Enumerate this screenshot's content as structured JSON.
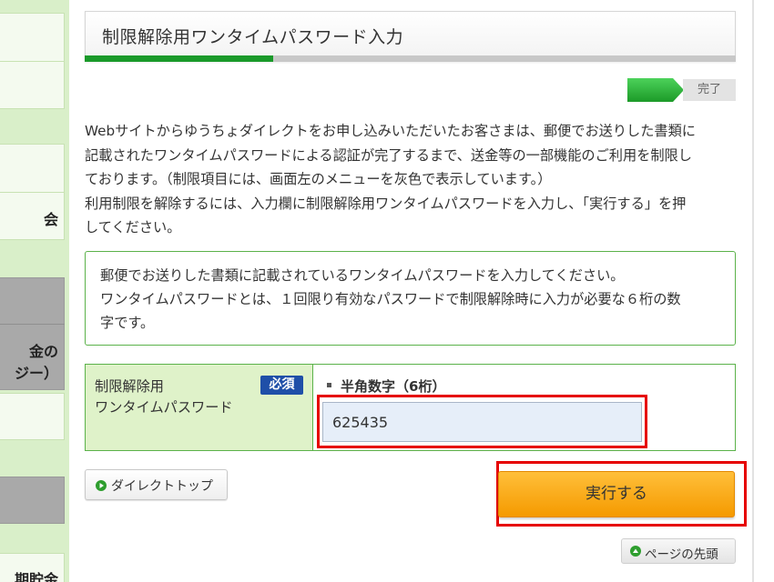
{
  "sidebar": {
    "items": [
      {
        "label": ""
      },
      {
        "label": ""
      },
      {
        "label": "会"
      },
      {
        "label": ""
      },
      {
        "label": "金の"
      },
      {
        "label": "ジー）"
      },
      {
        "label": ""
      },
      {
        "label": "期貯金"
      }
    ]
  },
  "header": {
    "title": "制限解除用ワンタイムパスワード入力",
    "progress": 0.29
  },
  "steps": {
    "current_label": "",
    "done_label": "完了"
  },
  "description": {
    "lines": [
      "Webサイトからゆうちょダイレクトをお申し込みいただいたお客さまは、郵便でお送りした書類に",
      "記載されたワンタイムパスワードによる認証が完了するまで、送金等の一部機能のご利用を制限し",
      "ております。（制限項目には、画面左のメニューを灰色で表示しています。）",
      "利用制限を解除するには、入力欄に制限解除用ワンタイムパスワードを入力し、「実行する」を押",
      "してください。"
    ]
  },
  "info": {
    "lines": [
      "郵便でお送りした書類に記載されているワンタイムパスワードを入力してください。",
      "ワンタイムパスワードとは、１回限り有効なパスワードで制限解除時に入力が必要な６桁の数",
      "字です。"
    ]
  },
  "form": {
    "label_line1": "制限解除用",
    "label_line2": "ワンタイムパスワード",
    "required_badge": "必須",
    "hint": "半角数字（6桁）",
    "otp_value": "625435"
  },
  "buttons": {
    "direct_top": "ダイレクトトップ",
    "execute": "実行する",
    "page_top": "ページの先頭"
  },
  "colors": {
    "accent_green": "#1a9a2a",
    "execute_orange": "#f59a00",
    "highlight_red": "#e60000",
    "required_blue": "#1f4fa8"
  }
}
